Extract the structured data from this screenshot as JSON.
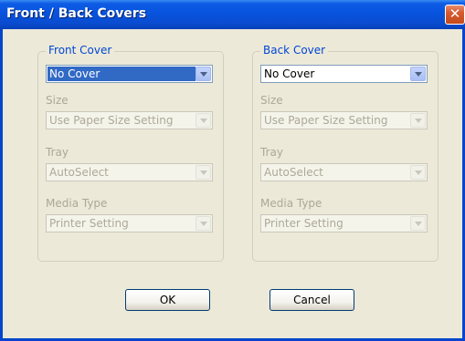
{
  "window": {
    "title": "Front / Back Covers",
    "close_label": "✕"
  },
  "front_cover": {
    "legend": "Front Cover",
    "cover": {
      "value": "No Cover"
    },
    "size": {
      "label": "Size",
      "value": "Use Paper Size Setting"
    },
    "tray": {
      "label": "Tray",
      "value": "AutoSelect"
    },
    "media_type": {
      "label": "Media Type",
      "value": "Printer Setting"
    }
  },
  "back_cover": {
    "legend": "Back Cover",
    "cover": {
      "value": "No Cover"
    },
    "size": {
      "label": "Size",
      "value": "Use Paper Size Setting"
    },
    "tray": {
      "label": "Tray",
      "value": "AutoSelect"
    },
    "media_type": {
      "label": "Media Type",
      "value": "Printer Setting"
    }
  },
  "buttons": {
    "ok": "OK",
    "cancel": "Cancel"
  },
  "colors": {
    "titlebar": "#0753dd",
    "dialog_bg": "#ece9d8",
    "selection": "#316ac5",
    "legend_text": "#0046d5",
    "disabled_text": "#aca899"
  }
}
